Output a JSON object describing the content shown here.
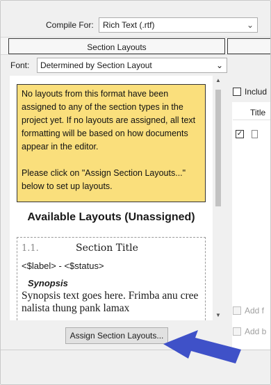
{
  "compile": {
    "label": "Compile For:",
    "value": "Rich Text (.rtf)"
  },
  "header": {
    "section_layouts_title": "Section Layouts"
  },
  "font": {
    "label": "Font:",
    "value": "Determined by Section Layout"
  },
  "notice": {
    "paragraph1": "No layouts from this format have been assigned to any of the section types in the project yet. If no layouts are assigned, all text formatting will be based on how documents appear in the editor.",
    "paragraph2": "Please click on \"Assign Section Layouts...\" below to set up layouts."
  },
  "available": {
    "title": "Available Layouts (Unassigned)",
    "preview": {
      "number": "1.1.",
      "section_title": "Section Title",
      "label_status": "<$label> - <$status>",
      "synopsis_heading": "Synopsis",
      "synopsis_text": "Synopsis text goes here. Frimba anu cree nalista thung pank lamax"
    }
  },
  "assign_button": {
    "label": "Assign Section Layouts..."
  },
  "right_panel": {
    "include_label": "Includ",
    "title_column": "Title",
    "add_front_label": "Add f",
    "add_back_label": "Add b"
  },
  "colors": {
    "notice_background": "#fadf7c",
    "arrow": "#3f51c8"
  },
  "icons": {
    "dropdown": "chevron-down-icon",
    "document": "document-icon",
    "scroll_up": "scroll-up-arrow-icon",
    "scroll_down": "scroll-down-arrow-icon",
    "arrow_annotation": "pointer-arrow-icon"
  }
}
